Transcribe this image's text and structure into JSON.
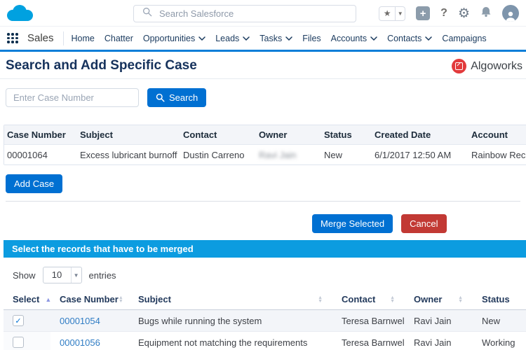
{
  "colors": {
    "accent_blue": "#0070d2",
    "cancel_red": "#c23934",
    "section_bar_blue": "#0c9ce0",
    "brand_red": "#e23a3c",
    "salesforce_blue": "#00a1e0",
    "heading_navy": "#16325c",
    "link_blue": "#2f7cc4"
  },
  "topbar": {
    "search_placeholder": "Search Salesforce",
    "icons": [
      "salesforce-logo",
      "search-icon",
      "favorites-star-icon",
      "favorites-caret-icon",
      "add-icon",
      "help-icon",
      "setup-icon",
      "notifications-bell-icon",
      "user-avatar"
    ]
  },
  "nav": {
    "app_name": "Sales",
    "tabs": [
      {
        "label": "Home",
        "dropdown": false
      },
      {
        "label": "Chatter",
        "dropdown": false
      },
      {
        "label": "Opportunities",
        "dropdown": true
      },
      {
        "label": "Leads",
        "dropdown": true
      },
      {
        "label": "Tasks",
        "dropdown": true
      },
      {
        "label": "Files",
        "dropdown": false
      },
      {
        "label": "Accounts",
        "dropdown": true
      },
      {
        "label": "Contacts",
        "dropdown": true
      },
      {
        "label": "Campaigns",
        "dropdown": false
      }
    ]
  },
  "page": {
    "title": "Search and Add Specific Case",
    "brand_name": "Algoworks"
  },
  "case_search": {
    "input_placeholder": "Enter Case Number",
    "search_button": "Search",
    "add_case_button": "Add Case"
  },
  "case_table": {
    "columns": [
      "Case Number",
      "Subject",
      "Contact",
      "Owner",
      "Status",
      "Created Date",
      "Account"
    ],
    "rows": [
      {
        "case_number": "00001064",
        "subject": "Excess lubricant burnoff",
        "contact": "Dustin Carreno",
        "owner": "Ravi Jain",
        "owner_blurred": true,
        "status": "New",
        "created_date": "6/1/2017 12:50 AM",
        "account": "Rainbow Records"
      }
    ]
  },
  "merge_panel": {
    "merge_button": "Merge Selected",
    "cancel_button": "Cancel",
    "bar_title": "Select the records that have to be merged",
    "show_label": "Show",
    "entries_per_page": "10",
    "entries_label": "entries"
  },
  "merge_table": {
    "columns": [
      "Select",
      "Case Number",
      "Subject",
      "Contact",
      "Owner",
      "Status"
    ],
    "sorted_column": "Select",
    "sort_direction": "asc",
    "rows": [
      {
        "selected": true,
        "case_number": "00001054",
        "subject": "Bugs while running the system",
        "contact": "Teresa Barnwell",
        "owner": "Ravi Jain",
        "status": "New"
      },
      {
        "selected": false,
        "case_number": "00001056",
        "subject": "Equipment not matching the requirements",
        "contact": "Teresa Barnwell",
        "owner": "Ravi Jain",
        "status": "Working"
      }
    ]
  }
}
